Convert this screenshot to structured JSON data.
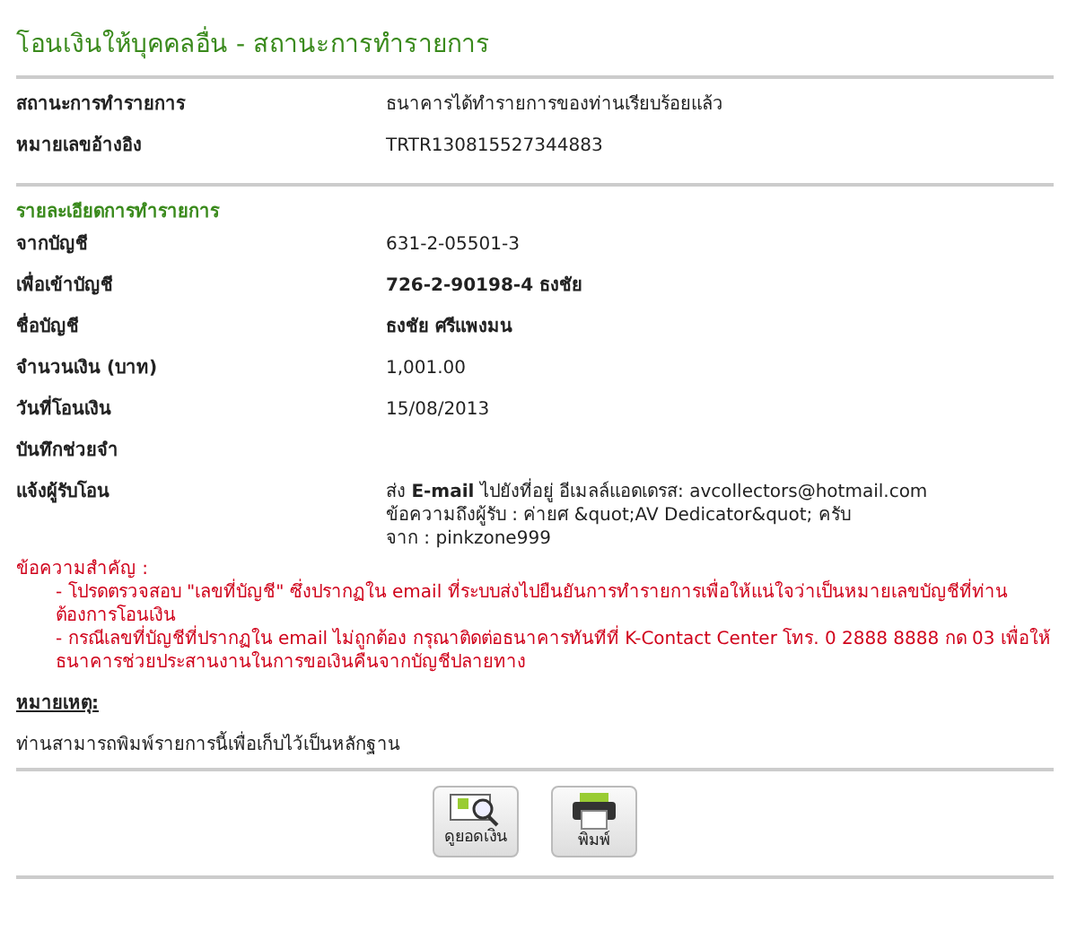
{
  "title": "โอนเงินให้บุคคลอื่น - สถานะการทำรายการ",
  "status_rows": [
    {
      "label": "สถานะการทำรายการ",
      "value": "ธนาคารได้ทำรายการของท่านเรียบร้อยแล้ว"
    },
    {
      "label": "หมายเลขอ้างอิง",
      "value": "TRTR130815527344883"
    }
  ],
  "details_heading": "รายละเอียดการทำรายการ",
  "detail_rows": [
    {
      "label": "จากบัญชี",
      "kind": "plain",
      "lines": [
        "631-2-05501-3"
      ]
    },
    {
      "label": "เพื่อเข้าบัญชี",
      "kind": "bold",
      "lines": [
        "726-2-90198-4 ธงชัย"
      ]
    },
    {
      "label": "ชื่อบัญชี",
      "kind": "bold",
      "lines": [
        "ธงชัย ศรีแพงมน"
      ]
    },
    {
      "label": "จำนวนเงิน (บาท)",
      "kind": "plain",
      "lines": [
        "1,001.00"
      ]
    },
    {
      "label": "วันที่โอนเงิน",
      "kind": "plain",
      "lines": [
        "15/08/2013"
      ]
    },
    {
      "label": "บันทึกช่วยจำ",
      "lines": []
    },
    {
      "label": "แจ้งผู้รับโอน",
      "kind": "plain",
      "lines": [
        "ส่ง **E-mail** ไปยังที่อยู่ อีเมลล์แอดเดรส: avcollectors@hotmail.com",
        "ข้อความถึงผู้รับ : ค่ายศ &quot;AV Dedicator&quot; ครับ",
        "จาก : pinkzone999"
      ]
    }
  ],
  "notice": {
    "heading": "ข้อความสำคัญ :",
    "items": [
      "- โปรดตรวจสอบ \"เลขที่บัญชี\" ซึ่งปรากฏใน email ที่ระบบส่งไปยืนยันการทำรายการเพื่อให้แน่ใจว่าเป็นหมายเลขบัญชีที่ท่านต้องการโอนเงิน",
      "- กรณีเลขที่บัญชีที่ปรากฏใน email ไม่ถูกต้อง กรุณาติดต่อธนาคารทันทีที่ K-Contact Center โทร. 0 2888 8888 กด 03 เพื่อให้ธนาคารช่วยประสานงานในการขอเงินคืนจากบัญชีปลายทาง"
    ]
  },
  "remark": {
    "heading": "หมายเหตุ:",
    "text": "ท่านสามารถพิมพ์รายการนี้เพื่อเก็บไว้เป็นหลักฐาน"
  },
  "buttons": [
    {
      "label": "ดูยอดเงิน",
      "kind": "balance"
    },
    {
      "label": "พิมพ์",
      "kind": "print"
    }
  ]
}
